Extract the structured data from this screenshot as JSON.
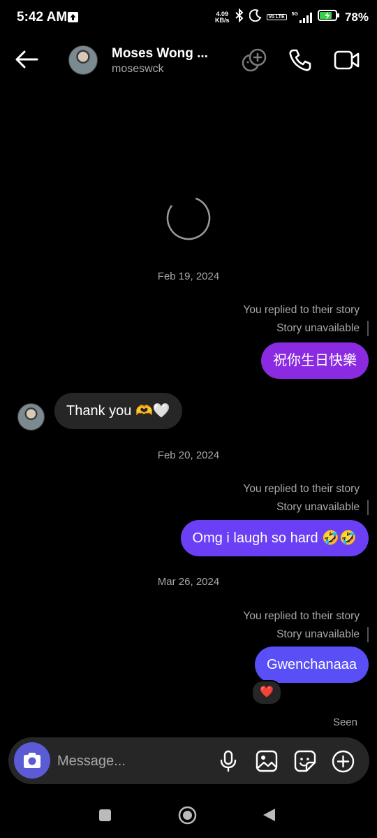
{
  "status_bar": {
    "time": "5:42 AM",
    "net_speed_value": "4.09",
    "net_speed_unit": "KB/s",
    "volte_label": "Vo LTE",
    "network_label": "5G",
    "battery_percent": "78%",
    "icons": [
      "upload-icon",
      "bluetooth-icon",
      "moon-icon",
      "signal-icon",
      "battery-icon"
    ]
  },
  "header": {
    "name": "Moses Wong ...",
    "username": "moseswck",
    "icons": [
      "back-arrow-icon",
      "avatar",
      "add-people-icon",
      "phone-icon",
      "video-icon"
    ]
  },
  "thread": [
    {
      "date": "Feb 19, 2024",
      "story_reply": "You replied to their story",
      "story_status": "Story unavailable",
      "outgoing_message": "祝你生日快樂"
    },
    {
      "incoming_message": "Thank you 🫶🤍"
    },
    {
      "date": "Feb 20, 2024",
      "story_reply": "You replied to their story",
      "story_status": "Story unavailable",
      "outgoing_message": "Omg i laugh so hard 🤣🤣"
    },
    {
      "date": "Mar 26, 2024",
      "story_reply": "You replied to their story",
      "story_status": "Story unavailable",
      "outgoing_message": "Gwenchanaaa",
      "reaction": "❤️"
    }
  ],
  "seen_label": "Seen",
  "composer": {
    "placeholder": "Message...",
    "icons": [
      "camera-icon",
      "microphone-icon",
      "gallery-icon",
      "sticker-icon",
      "plus-icon"
    ]
  },
  "colors": {
    "background": "#000000",
    "bubble_purple": "#8a2be2",
    "bubble_violet": "#6a3ff5",
    "bubble_blue": "#5a4ef6",
    "incoming_bubble": "#262626",
    "camera_button": "#5b5bd6"
  }
}
